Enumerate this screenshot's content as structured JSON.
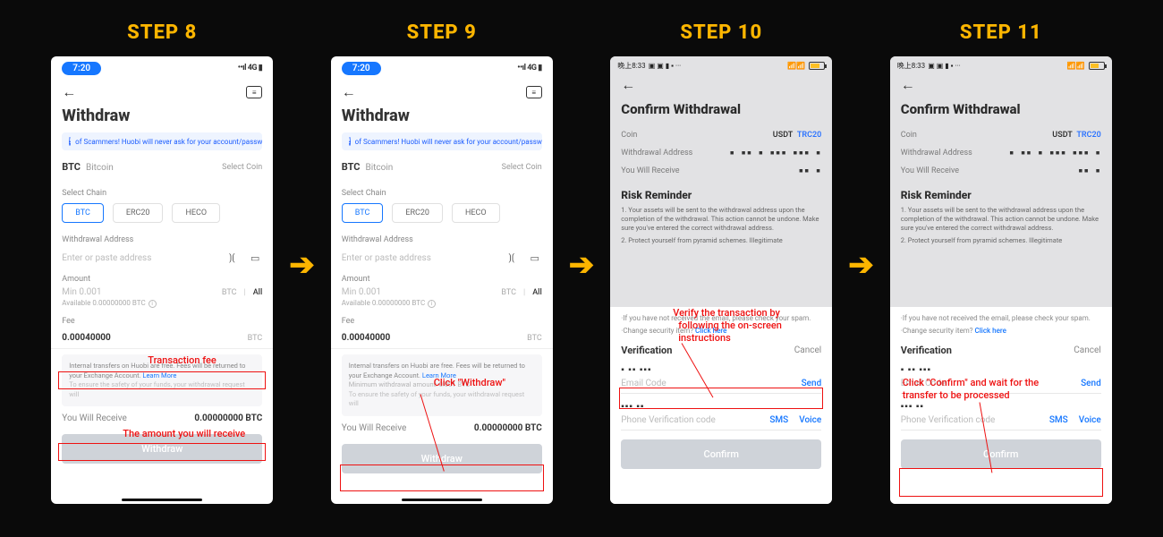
{
  "steps": [
    "STEP 8",
    "STEP 9",
    "STEP 10",
    "STEP 11"
  ],
  "ios": {
    "time": "7:20",
    "signal": "𝗜𝗹𝗹 4G ▮"
  },
  "android": {
    "time": "晚上8:33",
    "right": "📶 📶 🔋"
  },
  "withdraw": {
    "title": "Withdraw",
    "scam": "of Scammers! Huobi will never ask for your account/password/in",
    "coin_sym": "BTC",
    "coin_name": "Bitcoin",
    "select_coin": "Select Coin",
    "select_chain_label": "Select Chain",
    "chains": [
      "BTC",
      "ERC20",
      "HECO"
    ],
    "addr_label": "Withdrawal Address",
    "addr_ph": "Enter or paste address",
    "amount_label": "Amount",
    "amount_ph": "Min 0.001",
    "amount_unit": "BTC",
    "amount_all": "All",
    "available": "Available 0.00000000 BTC",
    "fee_label": "Fee",
    "fee_value": "0.00040000",
    "fee_unit": "BTC",
    "info1": "Internal transfers on Huobi are free. Fees will be returned to your Exchange Account.",
    "learn": "Learn More",
    "info2": "Minimum withdrawal amount: 0.001 BTC",
    "info3": "To ensure the safety of your funds, your withdrawal request will",
    "receive_label": "You Will Receive",
    "receive_value": "0.00000000 BTC",
    "withdraw_btn": "Withdraw"
  },
  "confirm": {
    "title": "Confirm Withdrawal",
    "coin_label": "Coin",
    "coin_value": "USDT",
    "coin_net": "TRC20",
    "addr_label": "Withdrawal Address",
    "addr_mask": "▪︎ ▪︎▪︎ ▪︎ ▪︎▪︎▪︎ ▪︎▪︎▪︎ ▪︎",
    "receive_label": "You Will Receive",
    "receive_mask": "▪︎▪︎ ▪︎",
    "risk_title": "Risk Reminder",
    "risk1": "1. Your assets will be sent to the withdrawal address upon the completion of the withdrawal. This action cannot be undone. Make sure you've entered the correct withdrawal address.",
    "risk2": "2. Protect yourself from pyramid schemes. Illegitimate"
  },
  "sheet": {
    "note1": "·If you have not received the email, please check your spam.",
    "note2": "·Change security item?",
    "note2_link": "Click here",
    "verif_title": "Verification",
    "cancel": "Cancel",
    "mask1": "▪ ▪▪ ▪▪▪",
    "email_ph": "Email Code",
    "send": "Send",
    "mask2": "▪▪▪  ▪▪",
    "phone_ph": "Phone Verification code",
    "sms": "SMS",
    "voice": "Voice",
    "confirm_btn": "Confirm"
  },
  "annotations": {
    "s8_fee": "Transaction fee",
    "s8_recv": "The amount you will receive",
    "s9_click": "Click \"Withdraw\"",
    "s10_verify1": "Verify the transaction by",
    "s10_verify2": "following the on-screen",
    "s10_verify3": "instructions",
    "s11_conf1": "Click \"Confirm\" and wait for the",
    "s11_conf2": "transfer to be processed"
  }
}
